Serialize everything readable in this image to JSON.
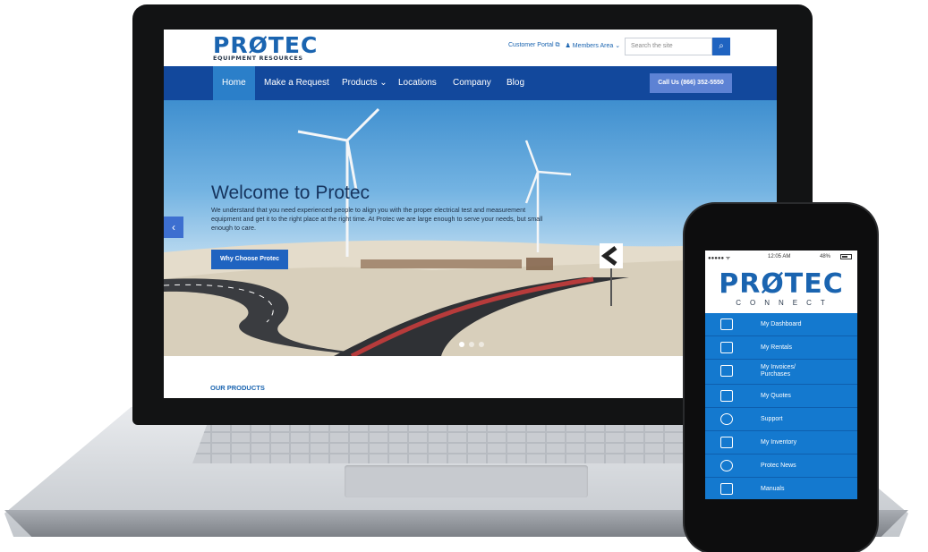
{
  "laptop_site": {
    "logo_main": "PRØTEC",
    "logo_sub": "EQUIPMENT RESOURCES",
    "header_links": {
      "customer_portal": "Customer Portal ⧉",
      "members_area": "♟ Members Area ⌄"
    },
    "search": {
      "placeholder": "Search the site"
    },
    "nav": {
      "items": [
        "Home",
        "Make a Request",
        "Products ⌄",
        "Locations",
        "Company",
        "Blog"
      ],
      "active": "Home",
      "call_button": "Call Us (866) 352-5550"
    },
    "hero": {
      "title": "Welcome to Protec",
      "text": "We understand that you need experienced people to align you with the proper electrical test and measurement equipment and get it to the right place at the right time. At Protec we are large enough to serve your needs, but small enough to care.",
      "button": "Why Choose Protec",
      "slide_count": 3,
      "active_slide": 1
    },
    "section_label": "OUR PRODUCTS"
  },
  "phone_app": {
    "status": {
      "carrier": "●●●●● ᯤ",
      "time": "12:05 AM",
      "battery": "48%"
    },
    "logo_main": "PRØTEC",
    "logo_sub": "CONNECT",
    "menu": [
      {
        "label": "My Dashboard",
        "icon": "dashboard-icon"
      },
      {
        "label": "My Rentals",
        "icon": "rentals-icon"
      },
      {
        "label": "My Invoices/ Purchases",
        "icon": "invoice-icon"
      },
      {
        "label": "My Quotes",
        "icon": "quote-icon"
      },
      {
        "label": "Support",
        "icon": "support-icon"
      },
      {
        "label": "My Inventory",
        "icon": "inventory-icon"
      },
      {
        "label": "Protec News",
        "icon": "news-icon"
      },
      {
        "label": "Manuals",
        "icon": "manual-icon"
      }
    ]
  },
  "colors": {
    "brand_blue": "#1a64b0",
    "nav_blue": "#12489c",
    "active_nav": "#2b7fc9",
    "app_menu_blue": "#1479cf"
  }
}
